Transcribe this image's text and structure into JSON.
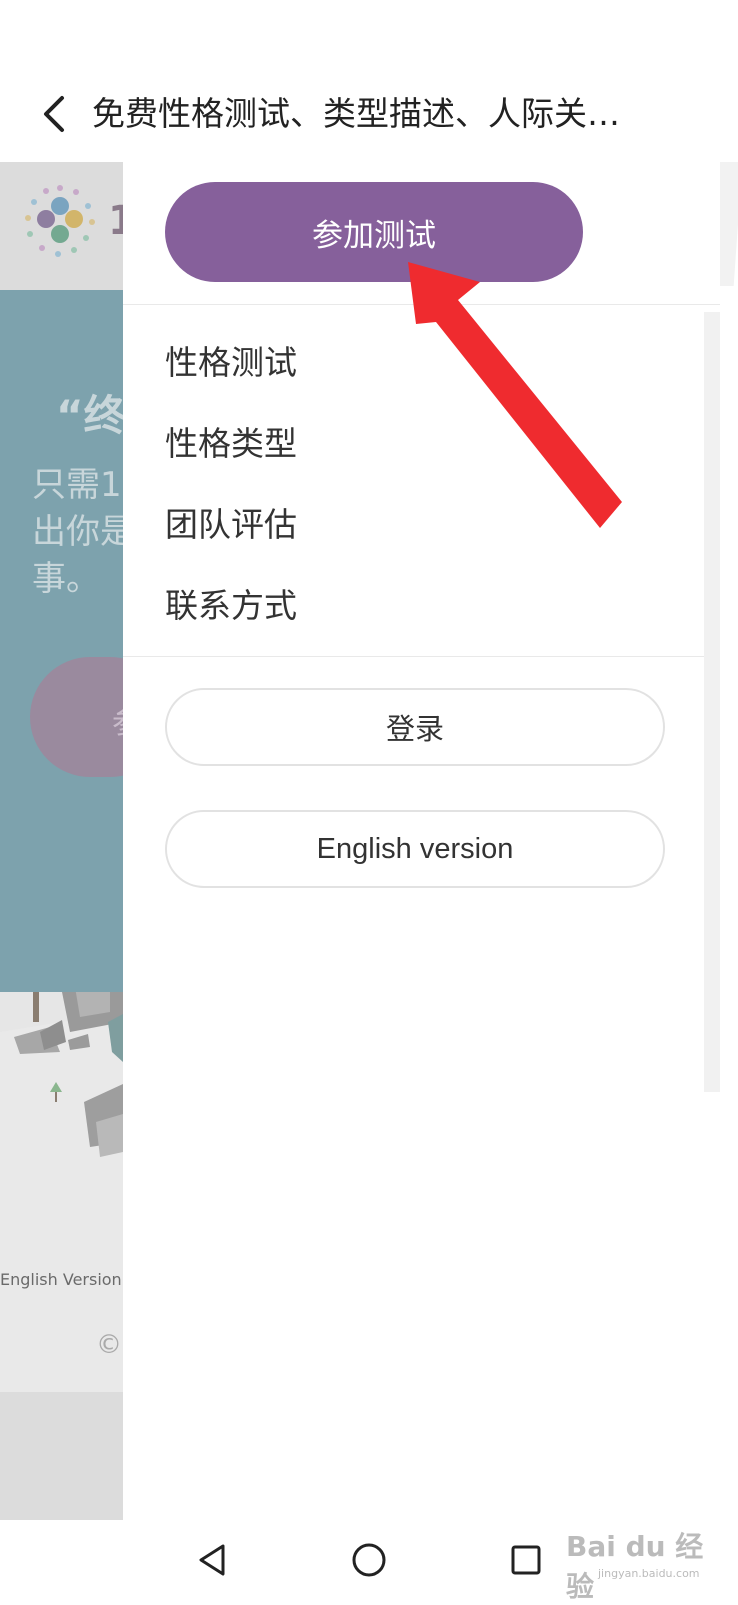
{
  "header": {
    "title": "免费性格测试、类型描述、人际关…"
  },
  "background_page": {
    "logo_text": "1",
    "quote": "“终",
    "text_lines": [
      "只需1",
      "出你是",
      "事。"
    ],
    "button_text": "参",
    "english_link": "English Version",
    "copyright": "©"
  },
  "drawer": {
    "take_test_label": "参加测试",
    "nav_items": [
      "性格测试",
      "性格类型",
      "团队评估",
      "联系方式"
    ],
    "login_label": "登录",
    "english_label": "English version"
  },
  "watermark": {
    "brand": "Bai du 经验",
    "url": "jingyan.baidu.com"
  },
  "colors": {
    "accent_purple": "#86609b",
    "arrow_red": "#ef2b2f"
  }
}
